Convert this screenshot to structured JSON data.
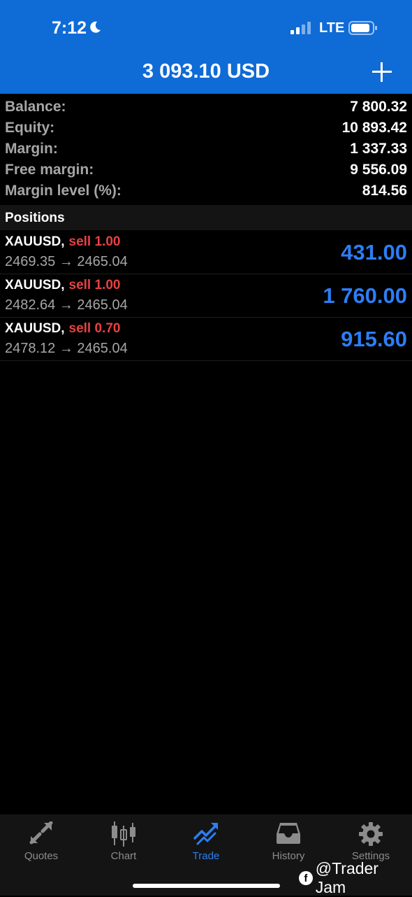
{
  "status_bar": {
    "time": "7:12",
    "network": "LTE"
  },
  "header": {
    "title": "3 093.10 USD",
    "add_icon": "plus-icon"
  },
  "summary": [
    {
      "label": "Balance:",
      "value": "7 800.32"
    },
    {
      "label": "Equity:",
      "value": "10 893.42"
    },
    {
      "label": "Margin:",
      "value": "1 337.33"
    },
    {
      "label": "Free margin:",
      "value": "9 556.09"
    },
    {
      "label": "Margin level (%):",
      "value": "814.56"
    }
  ],
  "positions": {
    "header": "Positions",
    "items": [
      {
        "symbol": "XAUUSD,",
        "side": "sell 1.00",
        "prices": "2469.35 → 2465.04",
        "profit": "431.00"
      },
      {
        "symbol": "XAUUSD,",
        "side": "sell 1.00",
        "prices": "2482.64 → 2465.04",
        "profit": "1 760.00"
      },
      {
        "symbol": "XAUUSD,",
        "side": "sell 0.70",
        "prices": "2478.12 → 2465.04",
        "profit": "915.60"
      }
    ]
  },
  "tabs": [
    {
      "label": "Quotes",
      "icon": "quotes-icon"
    },
    {
      "label": "Chart",
      "icon": "candlestick-chart-icon"
    },
    {
      "label": "Trade",
      "icon": "trade-trend-icon",
      "active": true
    },
    {
      "label": "History",
      "icon": "inbox-history-icon"
    },
    {
      "label": "Settings",
      "icon": "gear-icon"
    }
  ],
  "watermark": {
    "text": "@Trader Jam",
    "icon": "facebook-icon"
  },
  "colors": {
    "header_bg": "#0f6bd6",
    "profit": "#2c7ef5",
    "sell": "#e84141",
    "label_gray": "#a6a6a6",
    "active_tab": "#2c7ef5"
  }
}
